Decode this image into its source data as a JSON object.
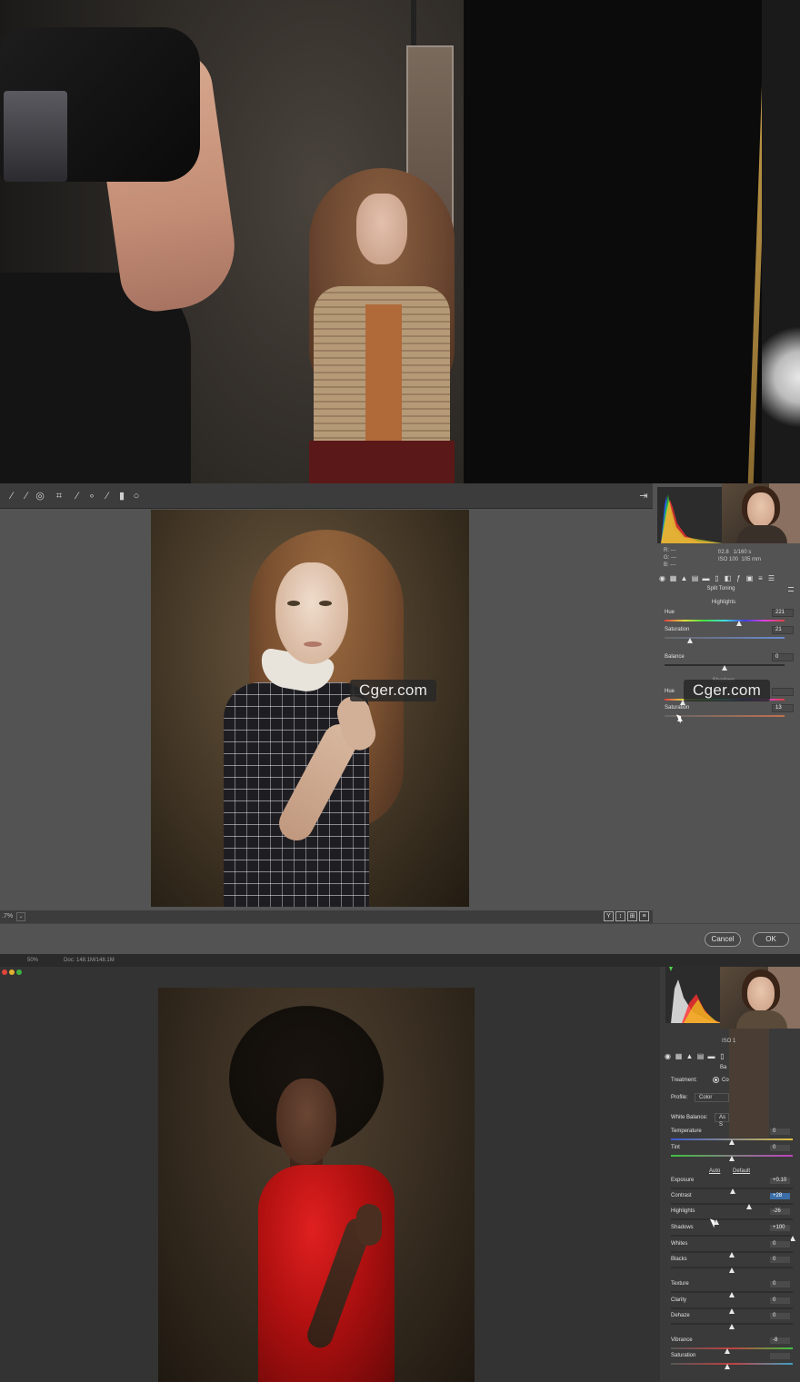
{
  "watermark": "Cger.com",
  "top_panel": {
    "split_toning": {
      "zoom": ".7%",
      "camera_info": {
        "r": "R:  ---",
        "g": "G:  ---",
        "b": "B:  ---",
        "aperture": "f/2.8",
        "shutter": "1/160 s",
        "iso": "ISO 100",
        "focal": "105 mm"
      },
      "panel_title": "Split Toning",
      "highlights_header": "Highlights",
      "shadows_header": "Shadows",
      "sliders": [
        {
          "label": "Hue",
          "value": "221",
          "position": 0.62
        },
        {
          "label": "Saturation",
          "value": "21",
          "position": 0.21
        },
        {
          "label": "Balance",
          "value": "0",
          "position": 0.5
        },
        {
          "label": "Hue",
          "value": "",
          "position": 0.15
        },
        {
          "label": "Saturation",
          "value": "13",
          "position": 0.13
        }
      ],
      "view_buttons": [
        "Y",
        "↕",
        "⊞",
        "≡"
      ],
      "cancel": "Cancel",
      "ok": "OK"
    }
  },
  "bottom_panel": {
    "titlebar": {
      "zoom": "50%",
      "doc": "Doc: 148.1M/148.1M"
    },
    "camera_info": {
      "iso": "ISO 1"
    },
    "panel_title": "Ba",
    "treatment_label": "Treatment:",
    "treatment_value": "Co",
    "profile_label": "Profile:",
    "profile_value": "Color",
    "white_balance_label": "White Balance:",
    "white_balance_value": "As S",
    "auto": "Auto",
    "default": "Default",
    "sliders": [
      {
        "label": "Temperature",
        "value": "0",
        "position": 0.5
      },
      {
        "label": "Tint",
        "value": "0",
        "position": 0.5
      },
      {
        "label": "Exposure",
        "value": "+0.10",
        "position": 0.51
      },
      {
        "label": "Contrast",
        "value": "+28",
        "position": 0.64,
        "selected": true
      },
      {
        "label": "Highlights",
        "value": "-26",
        "position": 0.37
      },
      {
        "label": "Shadows",
        "value": "+100",
        "position": 1.0
      },
      {
        "label": "Whites",
        "value": "0",
        "position": 0.5
      },
      {
        "label": "Blacks",
        "value": "0",
        "position": 0.5
      },
      {
        "label": "Texture",
        "value": "0",
        "position": 0.5
      },
      {
        "label": "Clarity",
        "value": "0",
        "position": 0.5
      },
      {
        "label": "Dehaze",
        "value": "0",
        "position": 0.5
      },
      {
        "label": "Vibrance",
        "value": "-8",
        "position": 0.46
      },
      {
        "label": "Saturation",
        "value": "",
        "position": 0.46
      }
    ]
  },
  "colors": {
    "panel_bg": "#535353",
    "dark_bg": "#333333",
    "selected": "#3b6ea8"
  }
}
